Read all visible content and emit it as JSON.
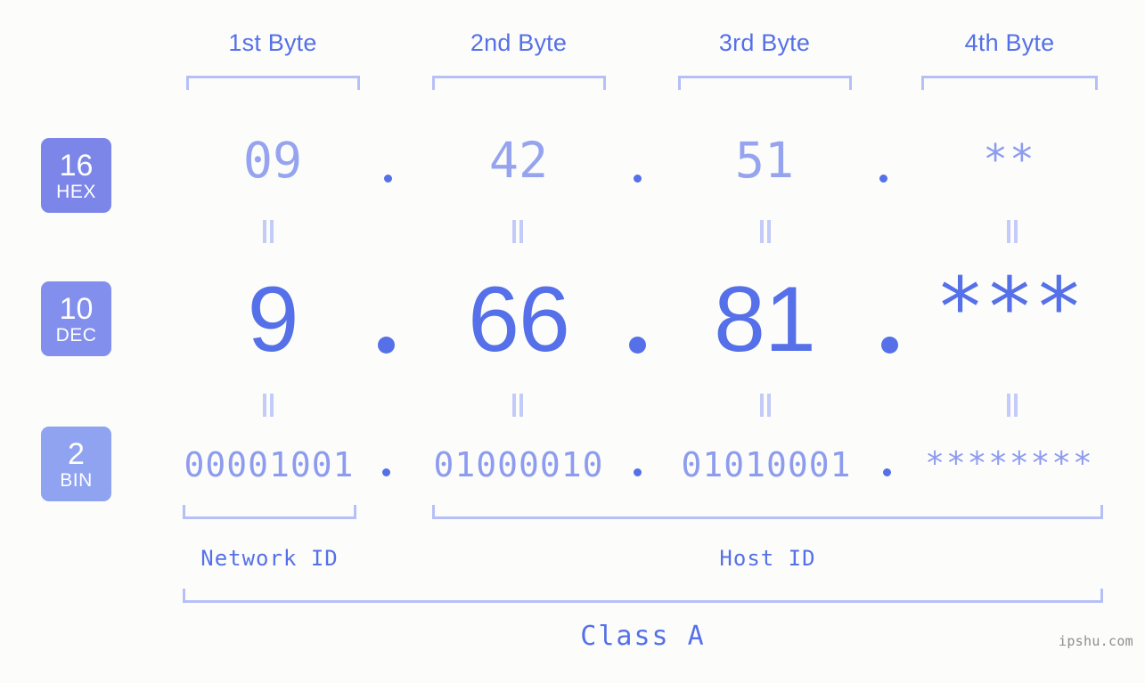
{
  "meta": {
    "watermark": "ipshu.com",
    "background_color": "#fcfdfa",
    "accent_color": "#5570e8",
    "accent_light_color": "#96a4f0",
    "bracket_color": "#b6c0f7"
  },
  "byte_headers": [
    {
      "label": "1st Byte"
    },
    {
      "label": "2nd Byte"
    },
    {
      "label": "3rd Byte"
    },
    {
      "label": "4th Byte"
    }
  ],
  "bases": [
    {
      "num": "16",
      "name": "HEX",
      "color": "#7b86e8"
    },
    {
      "num": "10",
      "name": "DEC",
      "color": "#838fec"
    },
    {
      "num": "2",
      "name": "BIN",
      "color": "#8fa3f0"
    }
  ],
  "rows": {
    "hex": {
      "base_num": "16",
      "base_name": "HEX",
      "values": [
        "09",
        "42",
        "51",
        "**"
      ],
      "separators": [
        ".",
        ".",
        "."
      ]
    },
    "dec": {
      "base_num": "10",
      "base_name": "DEC",
      "values": [
        "9",
        "66",
        "81",
        "***"
      ],
      "separators": [
        ".",
        ".",
        "."
      ]
    },
    "bin": {
      "base_num": "2",
      "base_name": "BIN",
      "values": [
        "00001001",
        "01000010",
        "01010001",
        "********"
      ],
      "separators": [
        ".",
        ".",
        "."
      ]
    }
  },
  "equals_marks": {
    "symbol": "=",
    "count_per_row": 4,
    "rows": 2
  },
  "id_sections": [
    {
      "label": "Network ID"
    },
    {
      "label": "Host ID"
    }
  ],
  "class_section": {
    "label": "Class A"
  }
}
